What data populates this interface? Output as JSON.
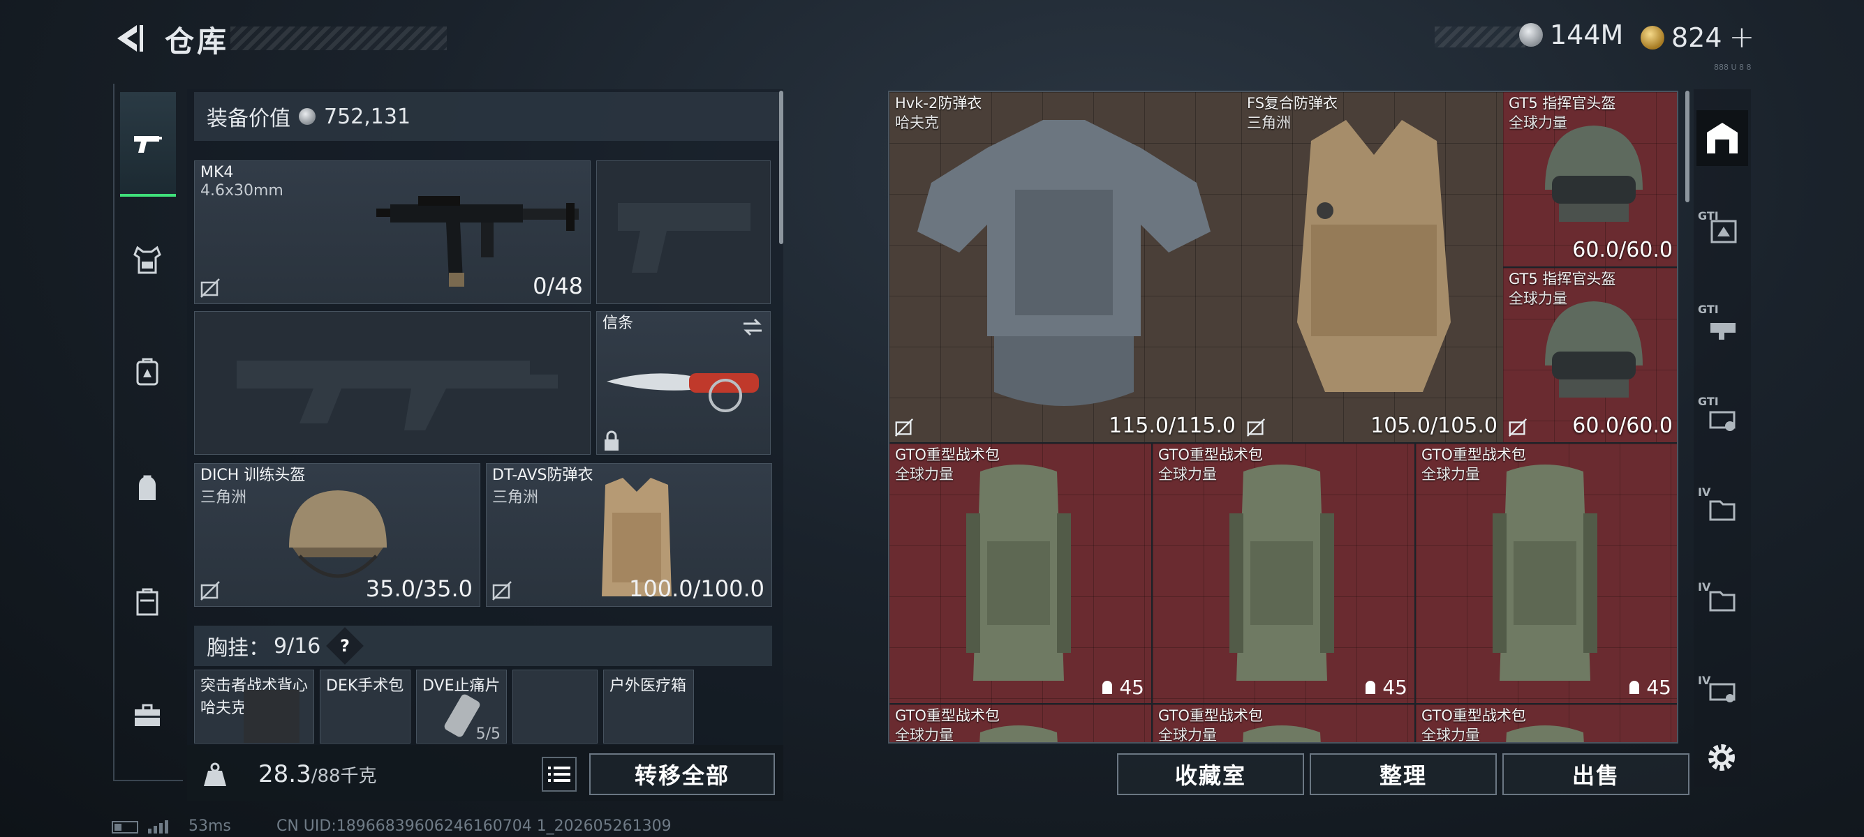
{
  "header": {
    "title": "仓库",
    "currency_silver": "144M",
    "currency_gold": "824",
    "gold_plus": "+",
    "top_tag": "888 U 8 8"
  },
  "left_rail": [
    "weapons",
    "armor",
    "backpack",
    "gear",
    "cases",
    "toolbox"
  ],
  "equipment": {
    "value_label": "装备价值",
    "value": "752,131",
    "primary": {
      "name": "MK4",
      "sub": "4.6x30mm",
      "ammo": "0/48"
    },
    "melee": {
      "name": "信条"
    },
    "helmet": {
      "name": "DICH 训练头盔",
      "sub": "三角洲",
      "durability": "35.0/35.0"
    },
    "armor": {
      "name": "DT-AVS防弹衣",
      "sub": "三角洲",
      "durability": "100.0/100.0"
    },
    "chest_label": "胸挂：",
    "chest_count": "9/16",
    "chest_help": "?",
    "chest_slots": [
      {
        "name": "突击者战术背心",
        "sub": "哈夫克"
      },
      {
        "name": "DEK手术包",
        "sub": ""
      },
      {
        "name": "DVE止痛片",
        "sub": "",
        "count": "5/5"
      },
      {
        "name": "",
        "sub": ""
      },
      {
        "name": "户外医疗箱",
        "sub": ""
      }
    ]
  },
  "weight": {
    "current": "28.3",
    "max": "/88千克"
  },
  "buttons": {
    "transfer_all": "转移全部",
    "collection": "收藏室",
    "organize": "整理",
    "sell": "出售"
  },
  "storage": [
    {
      "name": "Hvk-2防弹衣",
      "sub": "哈夫克",
      "durability": "115.0/115.0"
    },
    {
      "name": "FS复合防弹衣",
      "sub": "三角洲",
      "durability": "105.0/105.0"
    },
    {
      "name": "GT5 指挥官头盔",
      "sub": "全球力量",
      "durability": "60.0/60.0"
    },
    {
      "name": "GT5 指挥官头盔",
      "sub": "全球力量",
      "durability": "60.0/60.0"
    },
    {
      "name": "GTO重型战术包",
      "sub": "全球力量",
      "capacity": "45"
    },
    {
      "name": "GTO重型战术包",
      "sub": "全球力量",
      "capacity": "45"
    },
    {
      "name": "GTO重型战术包",
      "sub": "全球力量",
      "capacity": "45"
    },
    {
      "name": "GTO重型战术包",
      "sub": "全球力量"
    },
    {
      "name": "GTO重型战术包",
      "sub": "全球力量"
    },
    {
      "name": "GTO重型战术包",
      "sub": "全球力量"
    }
  ],
  "right_rail": {
    "labels": [
      "GTI",
      "GTI",
      "GTI",
      "IV",
      "IV",
      "IV"
    ]
  },
  "status": {
    "ping": "53ms",
    "uid": "CN UID:18966839606246160704 1_202605261309"
  },
  "colors": {
    "accent": "#3fe07a",
    "cell_red": "#6a2b30",
    "cell_brown": "#4a3f38"
  }
}
